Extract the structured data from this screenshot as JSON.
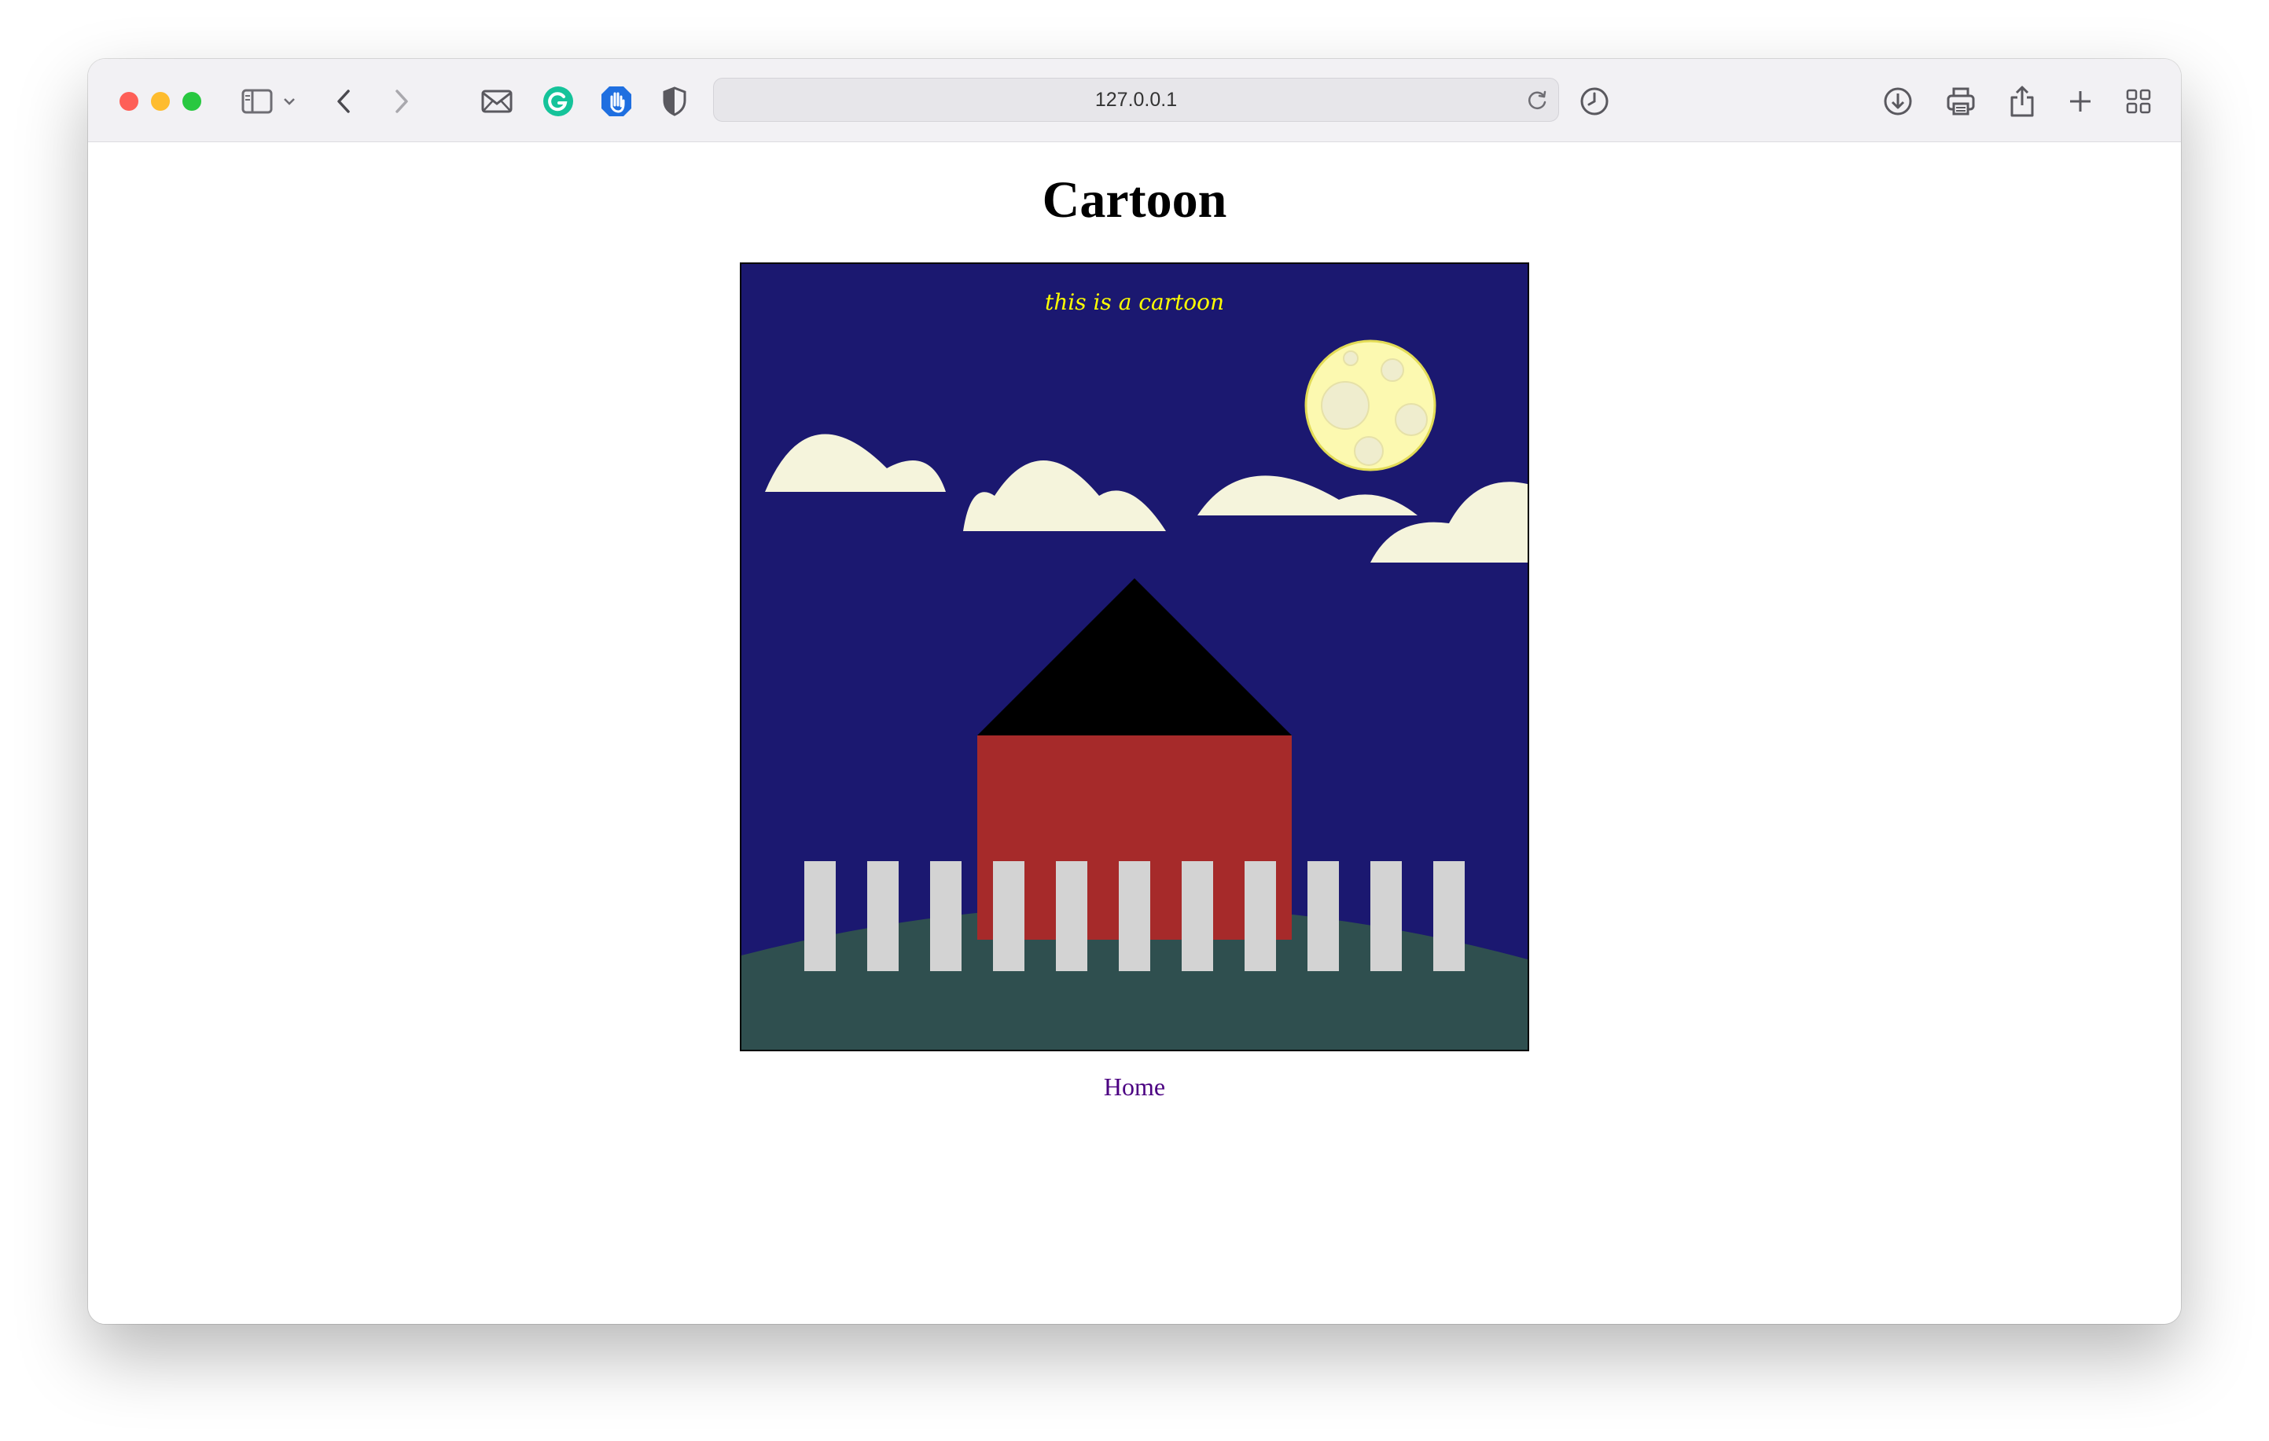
{
  "browser": {
    "url": "127.0.0.1",
    "traffic_lights": {
      "close": "#fe5f57",
      "minimize": "#febc2e",
      "maximize": "#28c840"
    },
    "toolbar_icons": [
      "sidebar-icon",
      "chevron-down-icon",
      "back-icon",
      "forward-icon",
      "mail-icon",
      "grammarly-icon",
      "hand-block-icon",
      "shield-icon",
      "reload-icon",
      "history-clock-icon",
      "download-icon",
      "print-icon",
      "share-icon",
      "new-tab-icon",
      "tab-overview-icon"
    ]
  },
  "page": {
    "title": "Cartoon",
    "home_link": "Home",
    "link_color": "#4b0082"
  },
  "cartoon": {
    "caption": "this is a cartoon",
    "colors": {
      "sky": "#1b1870",
      "moon": "#fcf9b0",
      "cloud": "#f5f4dc",
      "roof": "#000000",
      "house": "#a62a2a",
      "fence": "#d3d3d3",
      "hill": "#2f4f4f",
      "caption": "#ffff00"
    },
    "fence_pickets": 11
  }
}
